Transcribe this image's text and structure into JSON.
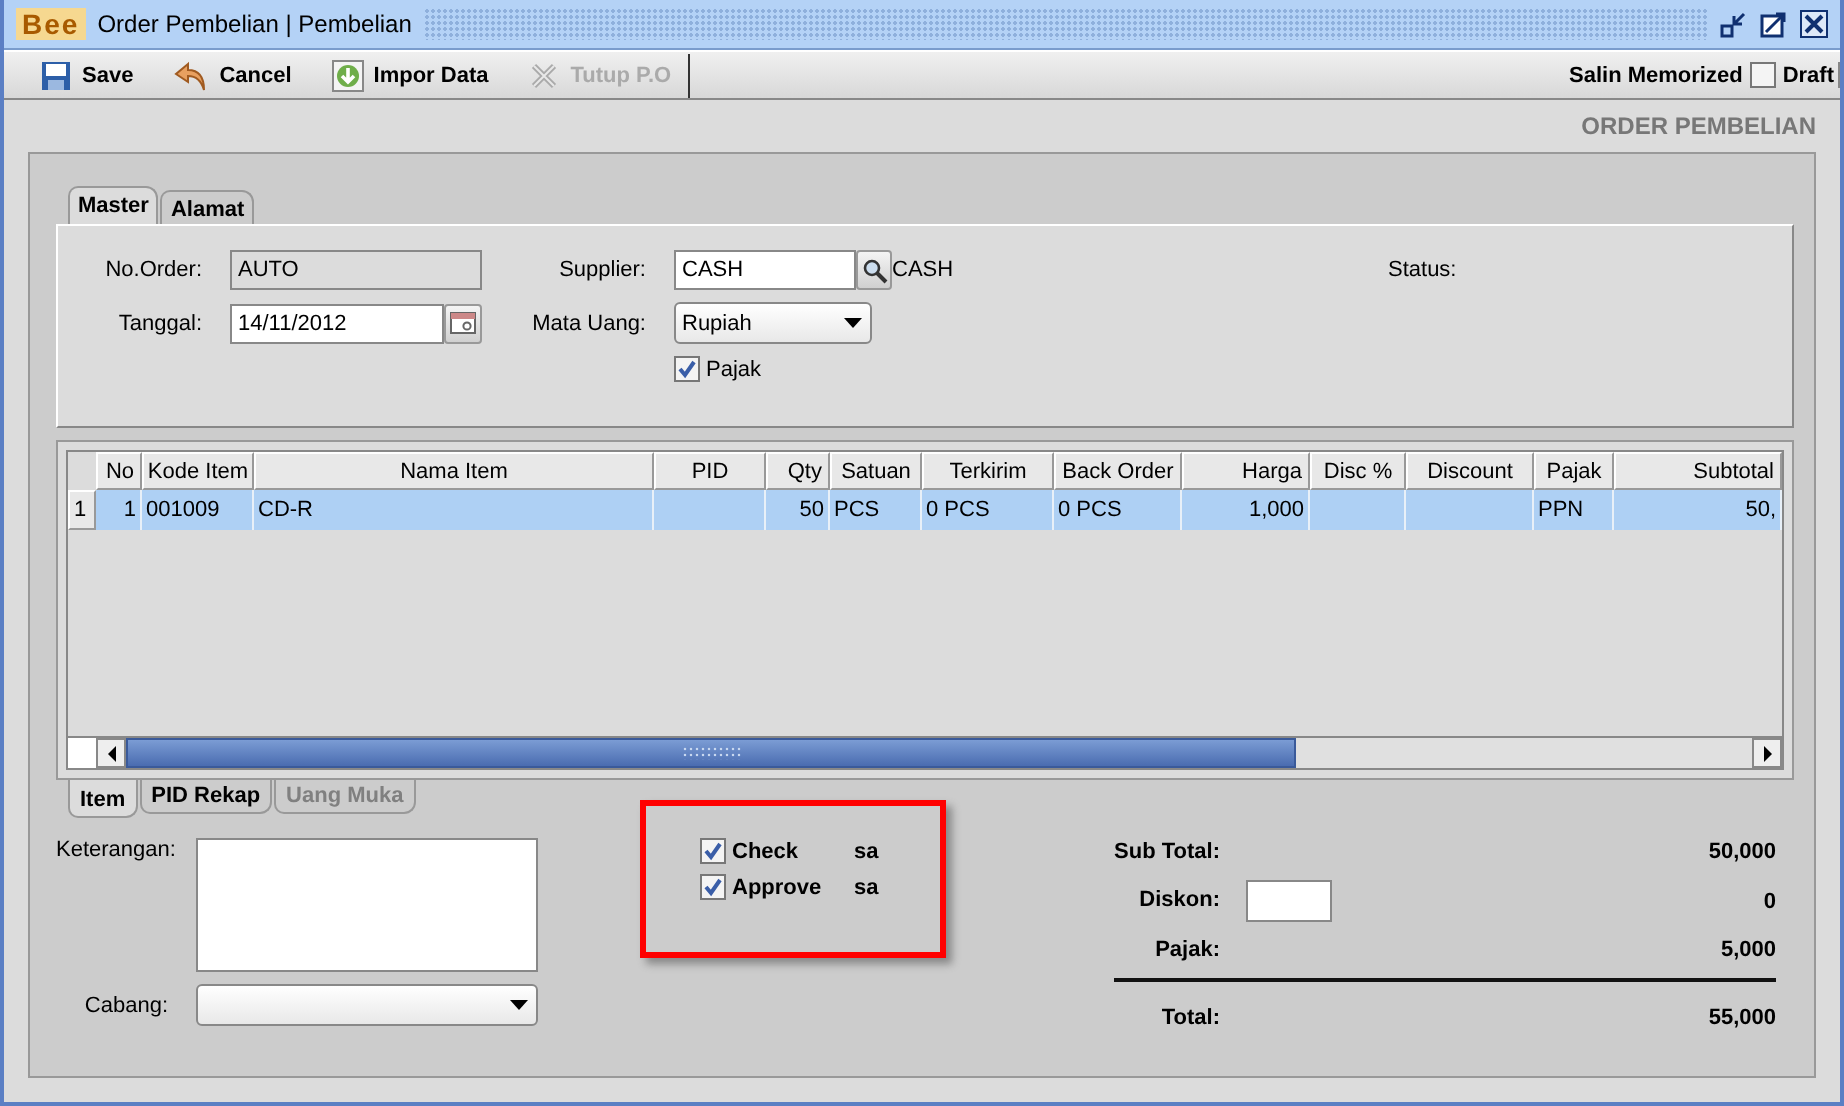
{
  "window": {
    "logo": "Bee",
    "title": "Order Pembelian | Pembelian"
  },
  "toolbar": {
    "buttons": [
      {
        "label": "Save",
        "kind": "save",
        "disabled": false
      },
      {
        "label": "Cancel",
        "kind": "cancel",
        "disabled": false
      },
      {
        "label": "Impor Data",
        "kind": "import",
        "disabled": false
      },
      {
        "label": "Tutup P.O",
        "kind": "close",
        "disabled": true
      }
    ],
    "copy_label": "Salin Memorized",
    "draft": {
      "label": "Draft",
      "checked": false
    }
  },
  "page_title": "ORDER PEMBELIAN",
  "header_tabs": [
    {
      "label": "Master",
      "selected": true
    },
    {
      "label": "Alamat",
      "selected": false
    }
  ],
  "master": {
    "no_order": {
      "label": "No.Order:",
      "value": "AUTO"
    },
    "tanggal": {
      "label": "Tanggal:",
      "value": "14/11/2012"
    },
    "supplier": {
      "label": "Supplier:",
      "value": "CASH",
      "name": "CASH"
    },
    "mata_uang": {
      "label": "Mata Uang:",
      "value": "Rupiah"
    },
    "pajak": {
      "label": "Pajak",
      "checked": true
    },
    "status": {
      "label": "Status:"
    }
  },
  "table": {
    "columns": [
      "No",
      "Kode Item",
      "Nama Item",
      "PID",
      "Qty",
      "Satuan",
      "Terkirim",
      "Back Order",
      "Harga",
      "Disc %",
      "Discount",
      "Pajak",
      "Subtotal"
    ],
    "rows": [
      {
        "number": "1",
        "selected": true,
        "cells": [
          "1",
          "001009",
          "CD-R",
          "",
          "50",
          "PCS",
          "0 PCS",
          "0 PCS",
          "1,000",
          "",
          "",
          "PPN",
          "50,"
        ]
      }
    ]
  },
  "bottom_tabs": [
    {
      "label": "Item",
      "selected": true,
      "disabled": false
    },
    {
      "label": "PID Rekap",
      "selected": false,
      "disabled": false
    },
    {
      "label": "Uang Muka",
      "selected": false,
      "disabled": true
    }
  ],
  "keterangan": {
    "label": "Keterangan:"
  },
  "cabang": {
    "label": "Cabang:"
  },
  "approvals": [
    {
      "label": "Check",
      "checked": true,
      "user": "sa"
    },
    {
      "label": "Approve",
      "checked": true,
      "user": "sa"
    }
  ],
  "totals": [
    {
      "label": "Sub Total:",
      "value": "50,000",
      "kind": "plain"
    },
    {
      "label": "Diskon:",
      "value": "0",
      "kind": "input"
    },
    {
      "label": "Pajak:",
      "value": "5,000",
      "kind": "plain"
    },
    {
      "label": "Total:",
      "value": "55,000",
      "kind": "total"
    }
  ]
}
